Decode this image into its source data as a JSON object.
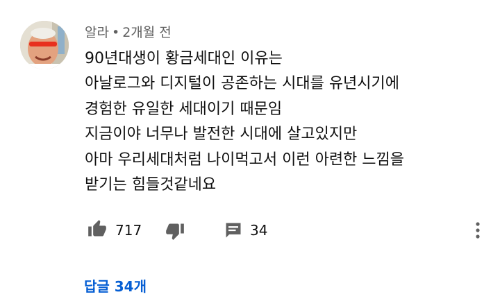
{
  "comment": {
    "author": "알라",
    "separator": "•",
    "time": "2개월 전",
    "lines": [
      "90년대생이 황금세대인 이유는",
      "아날로그와 디지털이 공존하는 시대를 유년시기에",
      "경험한 유일한 세대이기 때문임",
      "지금이야 너무나 발전한 시대에 살고있지만",
      "아마 우리세대처럼 나이먹고서 이런 아련한 느낌을",
      "받기는 힘들것같네요"
    ],
    "likes": "717",
    "reply_count": "34",
    "replies_label": "답글 34개"
  },
  "icons": {
    "like": "thumbs-up-icon",
    "dislike": "thumbs-down-icon",
    "reply": "comment-icon",
    "more": "more-vert-icon"
  },
  "colors": {
    "text": "#0f0f0f",
    "meta": "#606060",
    "link": "#065fd4",
    "icon": "#606060"
  }
}
